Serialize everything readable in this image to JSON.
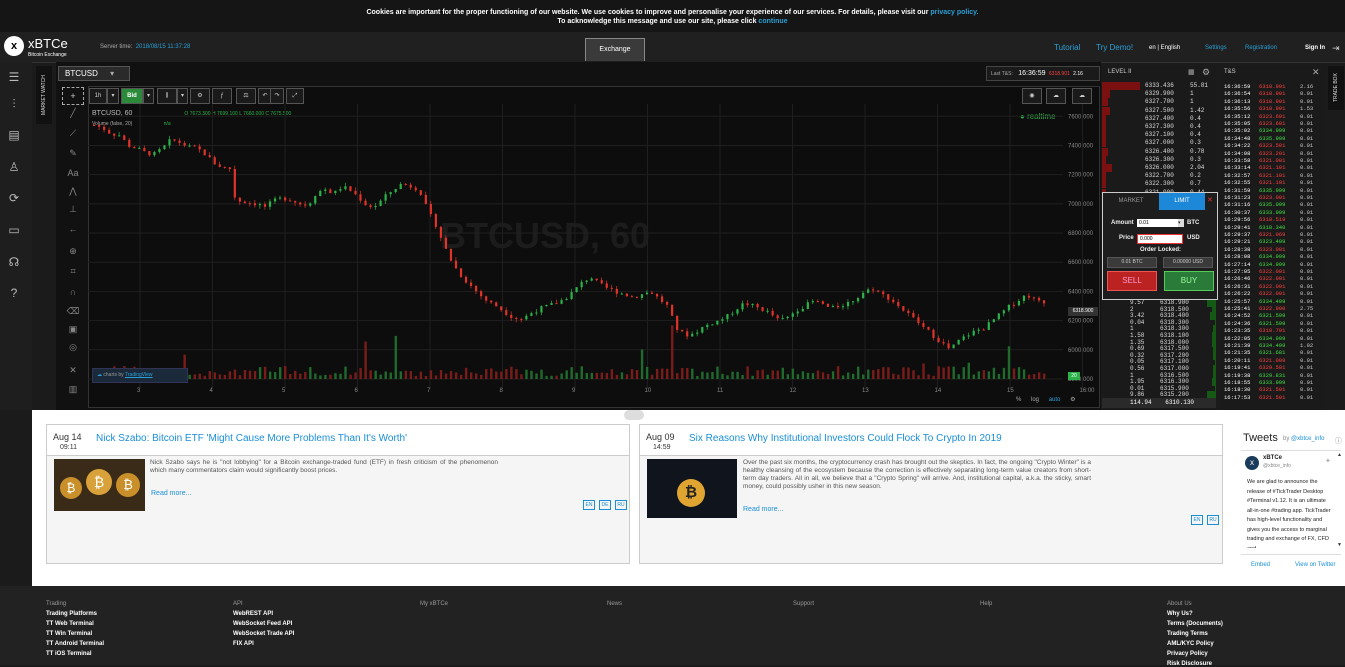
{
  "cookie": {
    "line1": "Cookies are important for the proper functioning of our website. We use cookies to improve and personalise your experience of our services. For details, please visit our",
    "line1_link": "privacy policy.",
    "line2": "To acknowledge this message and use our site, please click",
    "line2_link": "continue"
  },
  "header": {
    "logo_mark": "x",
    "logo_text": "xBTCe",
    "logo_sub": "Bitcoin Exchange",
    "server_time_label": "Server time:",
    "server_time": "2018/08/15 11:37:28",
    "exchange_tab": "Exchange",
    "tutorial": "Tutorial",
    "try_demo": "Try Demo!",
    "language": "en | English",
    "settings": "Settings",
    "registration": "Registration",
    "sign_in": "Sign In"
  },
  "sidebar": {
    "market_watch": "MARKET WATCH",
    "trade_box": "TRADE BOX"
  },
  "chart_panel": {
    "symbol": "BTCUSD",
    "last_ts_label": "Last T&S:",
    "last_ts_time": "16:36:59",
    "last_ts_price": "6318.901",
    "last_ts_qty": "2.16",
    "resolution": "1h",
    "bid_label": "Bid",
    "legend_symbol": "BTCUSD, 60",
    "ohlc": "O 7673.300 H 7699.100 L 7660.000 C 7675.500",
    "volume_label": "Volume (false, 20)",
    "volume_value": "n/a",
    "realtime": "realtime",
    "watermark": "BTCUSD, 60",
    "current_price_tag": "6318.900",
    "volume_tag": "20",
    "attribution_prefix": "charts by",
    "attribution": "TradingView",
    "footer_percent": "%",
    "footer_log": "log",
    "footer_auto": "auto"
  },
  "chart_data": {
    "type": "candlestick",
    "title": "BTCUSD, 60",
    "x_ticks": [
      "3",
      "4",
      "5",
      "6",
      "7",
      "8",
      "9",
      "10",
      "11",
      "12",
      "13",
      "14",
      "15",
      "16:00"
    ],
    "y_ticks": [
      7600,
      7400,
      7200,
      7000,
      6800,
      6600,
      6400,
      6200,
      6000,
      5800
    ],
    "ylim": [
      5800,
      7650
    ],
    "close_path": [
      [
        0,
        7540
      ],
      [
        5,
        7520
      ],
      [
        10,
        7480
      ],
      [
        15,
        7470
      ],
      [
        20,
        7400
      ],
      [
        25,
        7380
      ],
      [
        30,
        7350
      ],
      [
        35,
        7340
      ],
      [
        40,
        7380
      ],
      [
        45,
        7440
      ],
      [
        50,
        7420
      ],
      [
        55,
        7390
      ],
      [
        60,
        7380
      ],
      [
        65,
        7340
      ],
      [
        70,
        7280
      ],
      [
        75,
        7250
      ],
      [
        80,
        7240
      ],
      [
        82,
        7050
      ],
      [
        85,
        7020
      ],
      [
        90,
        7010
      ],
      [
        95,
        7000
      ],
      [
        100,
        6980
      ],
      [
        105,
        7020
      ],
      [
        110,
        7040
      ],
      [
        115,
        7030
      ],
      [
        120,
        7000
      ],
      [
        125,
        6990
      ],
      [
        130,
        7080
      ],
      [
        135,
        7100
      ],
      [
        140,
        7070
      ],
      [
        145,
        7120
      ],
      [
        150,
        7090
      ],
      [
        155,
        7040
      ],
      [
        160,
        6980
      ],
      [
        165,
        6990
      ],
      [
        170,
        7050
      ],
      [
        175,
        7100
      ],
      [
        180,
        7140
      ],
      [
        185,
        7120
      ],
      [
        190,
        7100
      ],
      [
        195,
        6950
      ],
      [
        200,
        6850
      ],
      [
        205,
        6700
      ],
      [
        210,
        6580
      ],
      [
        215,
        6500
      ],
      [
        220,
        6440
      ],
      [
        225,
        6380
      ],
      [
        230,
        6330
      ],
      [
        235,
        6300
      ],
      [
        240,
        6260
      ],
      [
        245,
        6220
      ],
      [
        250,
        6210
      ],
      [
        255,
        6250
      ],
      [
        260,
        6280
      ],
      [
        265,
        6300
      ],
      [
        270,
        6320
      ],
      [
        275,
        6350
      ],
      [
        280,
        6400
      ],
      [
        285,
        6460
      ],
      [
        290,
        6500
      ],
      [
        295,
        6450
      ],
      [
        300,
        6420
      ],
      [
        305,
        6400
      ],
      [
        310,
        6380
      ],
      [
        315,
        6360
      ],
      [
        320,
        6380
      ],
      [
        325,
        6400
      ],
      [
        330,
        6350
      ],
      [
        335,
        6300
      ],
      [
        340,
        6150
      ],
      [
        345,
        6100
      ],
      [
        350,
        6110
      ],
      [
        355,
        6150
      ],
      [
        360,
        6180
      ],
      [
        365,
        6200
      ],
      [
        370,
        6230
      ],
      [
        375,
        6280
      ],
      [
        380,
        6320
      ],
      [
        385,
        6300
      ],
      [
        390,
        6280
      ],
      [
        395,
        6250
      ],
      [
        400,
        6200
      ],
      [
        405,
        6220
      ],
      [
        410,
        6270
      ],
      [
        415,
        6300
      ],
      [
        420,
        6330
      ],
      [
        425,
        6320
      ],
      [
        430,
        6280
      ],
      [
        435,
        6300
      ],
      [
        440,
        6320
      ],
      [
        445,
        6350
      ],
      [
        450,
        6400
      ],
      [
        455,
        6420
      ],
      [
        460,
        6380
      ],
      [
        465,
        6350
      ],
      [
        470,
        6300
      ],
      [
        475,
        6250
      ],
      [
        480,
        6200
      ],
      [
        485,
        6150
      ],
      [
        490,
        6100
      ],
      [
        495,
        6050
      ],
      [
        500,
        6000
      ],
      [
        505,
        6060
      ],
      [
        510,
        6100
      ],
      [
        515,
        6130
      ],
      [
        520,
        6150
      ],
      [
        525,
        6200
      ],
      [
        530,
        6250
      ],
      [
        535,
        6300
      ],
      [
        540,
        6340
      ],
      [
        545,
        6380
      ],
      [
        550,
        6340
      ],
      [
        555,
        6318
      ]
    ]
  },
  "order_book": {
    "level_label": "LEVEL II",
    "asks": [
      {
        "price": "6333.436",
        "qty": "55.81",
        "w": 0.95
      },
      {
        "price": "6329.900",
        "qty": "1",
        "w": 0.2
      },
      {
        "price": "6327.700",
        "qty": "1",
        "w": 0.15
      },
      {
        "price": "6327.500",
        "qty": "1.42",
        "w": 0.2
      },
      {
        "price": "6327.400",
        "qty": "0.4",
        "w": 0.1
      },
      {
        "price": "6327.300",
        "qty": "0.4",
        "w": 0.1
      },
      {
        "price": "6327.100",
        "qty": "0.4",
        "w": 0.1
      },
      {
        "price": "6327.000",
        "qty": "0.3",
        "w": 0.1
      },
      {
        "price": "6326.400",
        "qty": "0.78",
        "w": 0.15
      },
      {
        "price": "6326.300",
        "qty": "0.3",
        "w": 0.1
      },
      {
        "price": "6326.000",
        "qty": "2.04",
        "w": 0.25
      },
      {
        "price": "6322.700",
        "qty": "0.2",
        "w": 0.1
      },
      {
        "price": "6322.300",
        "qty": "0.7",
        "w": 0.1
      },
      {
        "price": "6321.000",
        "qty": "0.44",
        "w": 0.1
      }
    ],
    "bids": [
      {
        "qty": "9.57",
        "price": "6318.900",
        "w": 0.3
      },
      {
        "qty": "2",
        "price": "6318.500",
        "w": 0.15
      },
      {
        "qty": "3.42",
        "price": "6318.400",
        "w": 0.2
      },
      {
        "qty": "0.04",
        "price": "6318.300",
        "w": 0.05
      },
      {
        "qty": "1",
        "price": "6318.300",
        "w": 0.1
      },
      {
        "qty": "1.58",
        "price": "6318.100",
        "w": 0.15
      },
      {
        "qty": "1.35",
        "price": "6318.000",
        "w": 0.15
      },
      {
        "qty": "0.69",
        "price": "6317.500",
        "w": 0.1
      },
      {
        "qty": "0.32",
        "price": "6317.200",
        "w": 0.1
      },
      {
        "qty": "0.05",
        "price": "6317.100",
        "w": 0.05
      },
      {
        "qty": "0.56",
        "price": "6317.000",
        "w": 0.1
      },
      {
        "qty": "1",
        "price": "6316.500",
        "w": 0.1
      },
      {
        "qty": "1.95",
        "price": "6316.300",
        "w": 0.15
      },
      {
        "qty": "0.01",
        "price": "6315.900",
        "w": 0.05
      },
      {
        "qty": "9.86",
        "price": "6315.200",
        "w": 0.3
      }
    ],
    "total_qty": "114.94",
    "total_price": "6310.130"
  },
  "order_form": {
    "tab_market": "MARKET",
    "tab_limit": "LIMIT",
    "amount_label": "Amount",
    "amount_value": "0.01",
    "amount_unit": "BTC",
    "price_label": "Price",
    "price_value": "0.000",
    "price_unit": "USD",
    "order_locked_label": "Order Locked:",
    "locked_btc": "0.01 BTC",
    "locked_usd": "0.00000 USD",
    "sell": "SELL",
    "buy": "BUY"
  },
  "time_sales": {
    "title": "T&S",
    "rows": [
      {
        "t": "16:36:59",
        "p": "6318.901",
        "q": "2.16",
        "c": "red"
      },
      {
        "t": "16:36:54",
        "p": "6318.901",
        "q": "0.01",
        "c": "red"
      },
      {
        "t": "16:36:13",
        "p": "6318.901",
        "q": "0.01",
        "c": "red"
      },
      {
        "t": "16:35:56",
        "p": "6318.901",
        "q": "1.53",
        "c": "red"
      },
      {
        "t": "16:35:12",
        "p": "6323.601",
        "q": "0.01",
        "c": "red"
      },
      {
        "t": "16:35:05",
        "p": "6323.601",
        "q": "0.01",
        "c": "red"
      },
      {
        "t": "16:35:02",
        "p": "6334.999",
        "q": "0.01",
        "c": "green"
      },
      {
        "t": "16:34:48",
        "p": "6335.999",
        "q": "0.01",
        "c": "green"
      },
      {
        "t": "16:34:22",
        "p": "6323.501",
        "q": "0.01",
        "c": "red"
      },
      {
        "t": "16:34:08",
        "p": "6323.201",
        "q": "0.01",
        "c": "red"
      },
      {
        "t": "16:33:58",
        "p": "6321.001",
        "q": "0.01",
        "c": "red"
      },
      {
        "t": "16:33:14",
        "p": "6321.101",
        "q": "0.01",
        "c": "red"
      },
      {
        "t": "16:32:57",
        "p": "6321.101",
        "q": "0.01",
        "c": "red"
      },
      {
        "t": "16:32:55",
        "p": "6321.101",
        "q": "0.01",
        "c": "red"
      },
      {
        "t": "16:31:59",
        "p": "6335.999",
        "q": "0.01",
        "c": "green"
      },
      {
        "t": "16:31:23",
        "p": "6323.001",
        "q": "0.01",
        "c": "red"
      },
      {
        "t": "16:31:16",
        "p": "6335.099",
        "q": "0.01",
        "c": "green"
      },
      {
        "t": "16:30:37",
        "p": "6333.999",
        "q": "0.01",
        "c": "green"
      },
      {
        "t": "16:29:56",
        "p": "6318.519",
        "q": "0.01",
        "c": "red"
      },
      {
        "t": "16:29:41",
        "p": "6318.340",
        "q": "0.01",
        "c": "green"
      },
      {
        "t": "16:29:37",
        "p": "6321.069",
        "q": "0.01",
        "c": "red"
      },
      {
        "t": "16:29:21",
        "p": "6323.499",
        "q": "0.01",
        "c": "green"
      },
      {
        "t": "16:28:38",
        "p": "6323.001",
        "q": "0.01",
        "c": "red"
      },
      {
        "t": "16:28:08",
        "p": "6334.999",
        "q": "0.01",
        "c": "green"
      },
      {
        "t": "16:27:14",
        "p": "6334.999",
        "q": "0.01",
        "c": "green"
      },
      {
        "t": "16:27:05",
        "p": "6322.001",
        "q": "0.01",
        "c": "red"
      },
      {
        "t": "16:26:46",
        "p": "6322.001",
        "q": "0.01",
        "c": "red"
      },
      {
        "t": "16:26:31",
        "p": "6322.001",
        "q": "0.01",
        "c": "red"
      },
      {
        "t": "16:26:22",
        "p": "6322.001",
        "q": "0.01",
        "c": "red"
      },
      {
        "t": "16:25:57",
        "p": "6334.499",
        "q": "0.01",
        "c": "green"
      },
      {
        "t": "16:25:41",
        "p": "6322.900",
        "q": "2.75",
        "c": "red"
      },
      {
        "t": "16:24:52",
        "p": "6321.599",
        "q": "0.01",
        "c": "green"
      },
      {
        "t": "16:24:36",
        "p": "6321.599",
        "q": "0.01",
        "c": "green"
      },
      {
        "t": "16:23:35",
        "p": "6318.701",
        "q": "0.01",
        "c": "red"
      },
      {
        "t": "16:22:05",
        "p": "6334.999",
        "q": "0.01",
        "c": "green"
      },
      {
        "t": "16:21:39",
        "p": "6334.499",
        "q": "1.92",
        "c": "green"
      },
      {
        "t": "16:21:35",
        "p": "6321.681",
        "q": "0.01",
        "c": "green"
      },
      {
        "t": "16:20:11",
        "p": "6321.009",
        "q": "0.01",
        "c": "red"
      },
      {
        "t": "16:19:41",
        "p": "6329.501",
        "q": "0.01",
        "c": "red"
      },
      {
        "t": "16:19:38",
        "p": "6329.831",
        "q": "0.01",
        "c": "green"
      },
      {
        "t": "16:18:55",
        "p": "6333.999",
        "q": "0.01",
        "c": "green"
      },
      {
        "t": "16:18:30",
        "p": "6321.501",
        "q": "0.01",
        "c": "red"
      },
      {
        "t": "16:17:53",
        "p": "6321.501",
        "q": "0.01",
        "c": "red"
      }
    ]
  },
  "news": [
    {
      "date": "Aug 14",
      "time": "09:11",
      "title": "Nick Szabo: Bitcoin ETF 'Might Cause More Problems Than It's Worth'",
      "text": "Nick Szabo says he is \"not lobbying\" for a Bitcoin exchange-traded fund (ETF) in fresh criticism of the phenomenon which many commentators claim would significantly boost prices.",
      "more": "Read more...",
      "langs": [
        "EN",
        "DE",
        "RU"
      ]
    },
    {
      "date": "Aug 09",
      "time": "14:59",
      "title": "Six Reasons Why Institutional Investors Could Flock To Crypto In 2019",
      "text": "Over the past six months, the cryptocurrency crash has brought out the skeptics. In fact, the ongoing \"Crypto Winter\" is a healthy cleansing of the ecosystem because the correction is effectively separating long-term value creators from short-term day traders. All in all, we believe that a \"Crypto Spring\" will arrive. And, institutional capital, a.k.a. the sticky, smart money, could possibly usher in this new season.",
      "more": "Read more...",
      "langs": [
        "EN",
        "RU"
      ]
    }
  ],
  "tweets": {
    "title": "Tweets",
    "by": "by",
    "handle": "@xbtce_info",
    "account": "xBTCe",
    "account_handle": "@xbtce_info",
    "text": "We are glad to announce the release of #TickTrader Desktop #Terminal v1.12. It is an ultimate all-in-one #trading app. TickTrader has high-level functionality and gives you the access to marginal trading and exchange of FX, CFD and",
    "embed": "Embed",
    "view_on": "View on Twitter"
  },
  "footer": {
    "columns": [
      {
        "head": "Trading",
        "links": [
          "Trading Platforms",
          "TT Web Terminal",
          "TT Win Terminal",
          "TT Android Terminal",
          "TT iOS Terminal"
        ]
      },
      {
        "head": "API",
        "links": [
          "WebREST API",
          "WebSocket Feed API",
          "WebSocket Trade API",
          "FIX API"
        ]
      },
      {
        "head": "My xBTCe",
        "links": []
      },
      {
        "head": "News",
        "links": []
      },
      {
        "head": "Support",
        "links": []
      },
      {
        "head": "Help",
        "links": []
      },
      {
        "head": "About Us",
        "links": [
          "Why Us?",
          "Terms (Documents)",
          "Trading Terms",
          "AML/KYC Policy",
          "Privacy Policy",
          "Risk Disclosure"
        ]
      }
    ]
  },
  "colors": {
    "accent": "#2a9fd6",
    "up": "#2bb34a",
    "down": "#e0332a",
    "sell": "#b22222",
    "buy": "#2a7a3a"
  }
}
